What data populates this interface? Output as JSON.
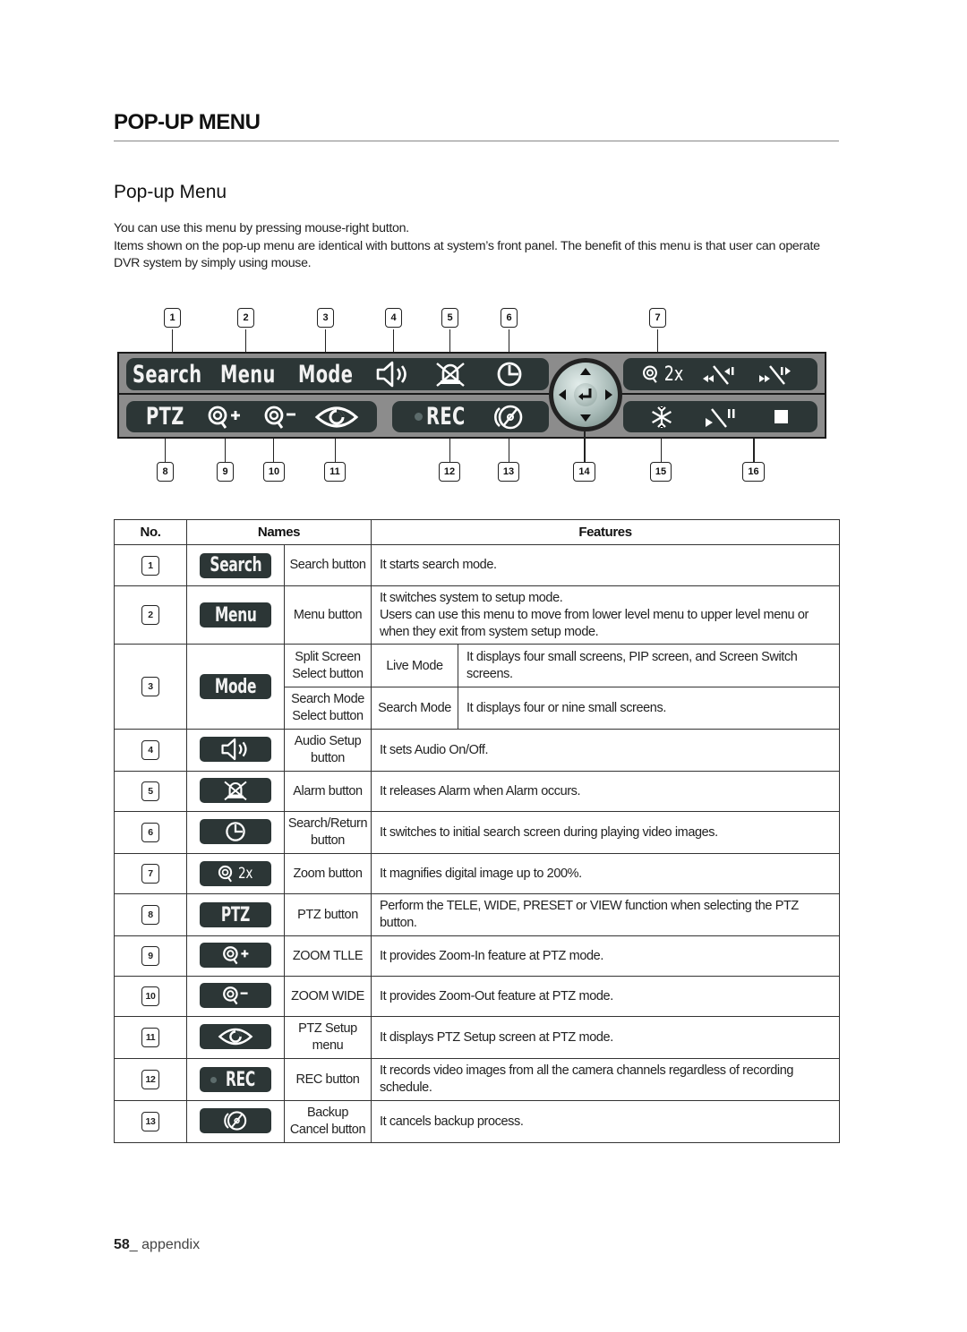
{
  "section_title": "POP-UP MENU",
  "subsection_title": "Pop-up Menu",
  "intro": [
    "You can use this menu by pressing mouse-right button.",
    "Items shown on the pop-up menu are identical with buttons at system’s front panel. The benefit of this menu is that user can operate DVR system by simply using mouse."
  ],
  "panel": {
    "top_row": {
      "left_pill": [
        "Search",
        "Menu",
        "Mode"
      ],
      "icons_left": [
        "speaker-icon",
        "alarm-icon",
        "clock-icon"
      ],
      "right_pill": {
        "zoom_label": "2x",
        "icons": [
          "zoom-2x-icon",
          "rewind-icon",
          "fast-forward-icon"
        ]
      }
    },
    "bottom_row": {
      "left_pill": {
        "label": "PTZ",
        "icons": [
          "zoom-in-icon",
          "zoom-out-icon",
          "eye-icon"
        ]
      },
      "mid_pill": {
        "label": "REC",
        "icons": [
          "rec-dot-icon",
          "backup-cancel-icon"
        ]
      },
      "right_pill": {
        "icons": [
          "freeze-icon",
          "play-pause-icon",
          "stop-icon"
        ]
      }
    },
    "joystick": "joystick-enter-icon",
    "callouts_top": [
      "1",
      "2",
      "3",
      "4",
      "5",
      "6",
      "7"
    ],
    "callouts_bottom": [
      "8",
      "9",
      "10",
      "11",
      "12",
      "13",
      "14",
      "15",
      "16"
    ]
  },
  "table": {
    "headers": {
      "no": "No.",
      "names": "Names",
      "features": "Features"
    },
    "rows": [
      {
        "no": "1",
        "button_label": "Search",
        "name": "Search button",
        "feature": "It starts search mode."
      },
      {
        "no": "2",
        "button_label": "Menu",
        "name": "Menu button",
        "feature": "It switches system to setup mode.\nUsers can use this menu to move from lower level menu to upper level menu or when they exit from system setup mode."
      },
      {
        "no": "3",
        "button_label": "Mode",
        "subrows": [
          {
            "name": "Split Screen Select button",
            "mode": "Live Mode",
            "feature": "It displays four small screens, PIP screen, and Screen Switch screens."
          },
          {
            "name": "Search Mode Select button",
            "mode": "Search Mode",
            "feature": "It displays four or nine small screens."
          }
        ]
      },
      {
        "no": "4",
        "icon": "speaker-icon",
        "name": "Audio Setup button",
        "feature": "It sets Audio On/Off."
      },
      {
        "no": "5",
        "icon": "alarm-icon",
        "name": "Alarm button",
        "feature": "It releases Alarm when Alarm occurs."
      },
      {
        "no": "6",
        "icon": "clock-icon",
        "name": "Search/Return button",
        "feature": "It switches to initial search screen during playing video images."
      },
      {
        "no": "7",
        "icon": "zoom-2x-icon",
        "button_label": "2x",
        "name": "Zoom button",
        "feature": "It magnifies digital image up to 200%."
      },
      {
        "no": "8",
        "button_label": "PTZ",
        "name": "PTZ button",
        "feature": "Perform the TELE, WIDE, PRESET or VIEW function when selecting the PTZ button."
      },
      {
        "no": "9",
        "icon": "zoom-in-icon",
        "name": "ZOOM TLLE",
        "feature": "It provides Zoom-In feature at PTZ mode."
      },
      {
        "no": "10",
        "icon": "zoom-out-icon",
        "name": "ZOOM WIDE",
        "feature": "It provides Zoom-Out feature at PTZ mode."
      },
      {
        "no": "11",
        "icon": "eye-icon",
        "name": "PTZ Setup menu",
        "feature": "It displays PTZ Setup screen at PTZ mode."
      },
      {
        "no": "12",
        "button_label": "REC",
        "name": "REC button",
        "feature": "It records video images from all the camera channels regardless of recording schedule."
      },
      {
        "no": "13",
        "icon": "backup-cancel-icon",
        "name": "Backup Cancel button",
        "feature": "It cancels backup process."
      }
    ]
  },
  "footer": {
    "page_number": "58",
    "section": "_ appendix"
  }
}
